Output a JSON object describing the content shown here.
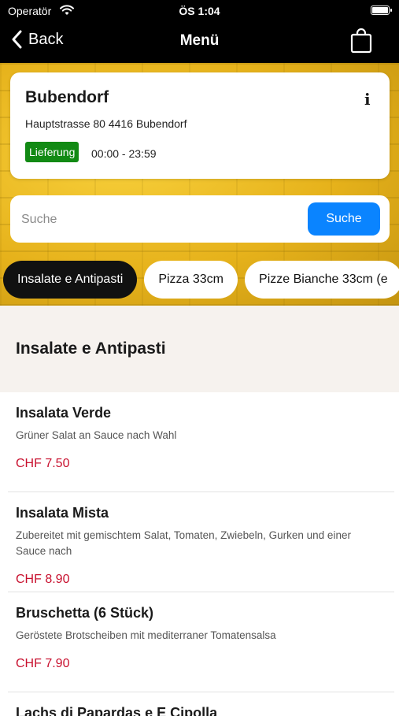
{
  "status_bar": {
    "carrier": "Operatör",
    "time": "ÖS 1:04"
  },
  "nav": {
    "back_label": "Back",
    "title": "Menü"
  },
  "store": {
    "name": "Bubendorf",
    "address": "Hauptstrasse 80 4416 Bubendorf",
    "badge": "Lieferung",
    "hours": "00:00 - 23:59",
    "info_glyph": "i"
  },
  "search": {
    "placeholder": "Suche",
    "value": "",
    "button_label": "Suche"
  },
  "categories": [
    {
      "label": "Insalate e Antipasti",
      "active": true
    },
    {
      "label": "Pizza 33cm",
      "active": false
    },
    {
      "label": "Pizze Bianche 33cm (e",
      "active": false
    }
  ],
  "section": {
    "title": "Insalate e Antipasti"
  },
  "items": [
    {
      "name": "Insalata Verde",
      "description": "Grüner Salat an Sauce nach Wahl",
      "price": "CHF 7.50"
    },
    {
      "name": "Insalata Mista",
      "description": "Zubereitet mit gemischtem Salat, Tomaten, Zwiebeln, Gurken und einer Sauce nach",
      "price": "CHF 8.90"
    },
    {
      "name": "Bruschetta (6 Stück)",
      "description": "Geröstete Brotscheiben mit mediterraner Tomatensalsa",
      "price": "CHF 7.90"
    },
    {
      "name": "Lachs di Papardas e E Cipolla",
      "description": "",
      "price": ""
    }
  ],
  "colors": {
    "accent": "#0a84ff",
    "price": "#c8102e",
    "badge": "#128a14",
    "chip_active": "#111111"
  },
  "icons": {
    "wifi": "wifi-icon",
    "battery": "battery-icon",
    "back": "chevron-left-icon",
    "bag": "shopping-bag-icon",
    "info": "info-icon"
  }
}
